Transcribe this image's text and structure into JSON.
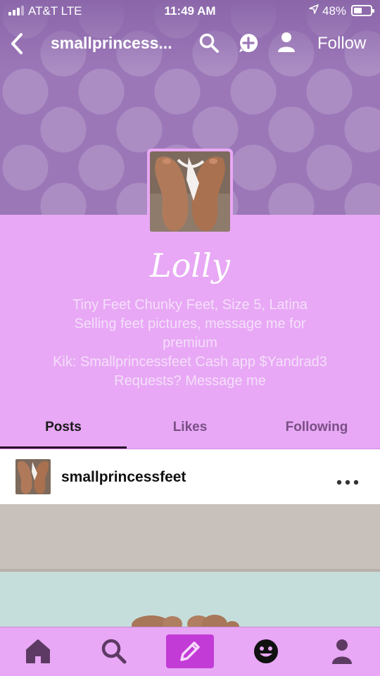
{
  "status_bar": {
    "carrier": "AT&T  LTE",
    "time": "11:49 AM",
    "battery_percent": "48%",
    "battery_level": 0.48
  },
  "nav": {
    "title": "smallprincess...",
    "follow_label": "Follow"
  },
  "profile": {
    "blog_title": "Lolly",
    "bio_lines": [
      "Tiny Feet Chunky Feet, Size 5, Latina",
      "Selling feet pictures, message me for",
      "premium",
      "Kik: Smallprincessfeet Cash app $Yandrad3",
      "Requests? Message me"
    ]
  },
  "tabs": [
    {
      "label": "Posts",
      "active": true
    },
    {
      "label": "Likes",
      "active": false
    },
    {
      "label": "Following",
      "active": false
    }
  ],
  "post": {
    "username": "smallprincessfeet"
  },
  "bottom_bar": {
    "items": [
      "home-icon",
      "search-icon",
      "compose-icon",
      "activity-icon",
      "account-icon"
    ]
  },
  "colors": {
    "header_bg": "#9b77b8",
    "profile_bg": "#e8a8f5",
    "accent": "#c23bd6"
  }
}
